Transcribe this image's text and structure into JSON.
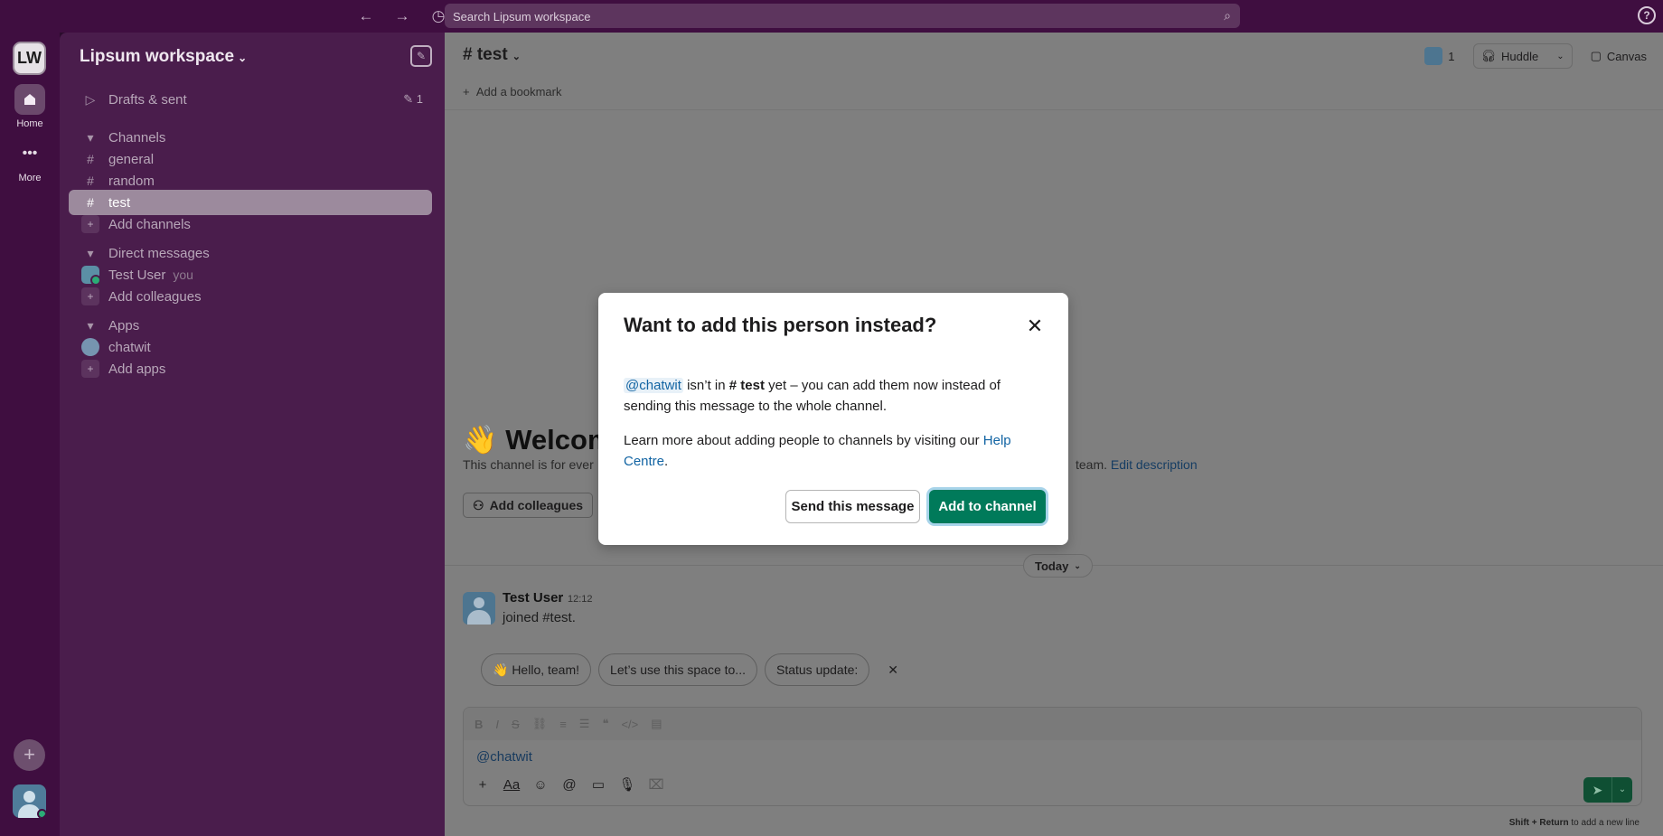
{
  "topbar": {
    "search_placeholder": "Search Lipsum workspace",
    "back_icon": "←",
    "forward_icon": "→",
    "history_icon": "◷",
    "help_icon": "?"
  },
  "rail": {
    "workspace_initials": "LW",
    "home_label": "Home",
    "more_label": "More"
  },
  "sidebar": {
    "workspace_name": "Lipsum workspace",
    "drafts_label": "Drafts & sent",
    "drafts_count": "1",
    "channels_header": "Channels",
    "channels": [
      "general",
      "random",
      "test"
    ],
    "add_channels": "Add channels",
    "dm_header": "Direct messages",
    "dm_user": "Test User",
    "dm_you": "you",
    "add_colleagues": "Add colleagues",
    "apps_header": "Apps",
    "app_name": "chatwit",
    "add_apps": "Add apps"
  },
  "channel": {
    "title": "test",
    "bookmark": "Add a bookmark",
    "member_count": "1",
    "huddle": "Huddle",
    "canvas": "Canvas",
    "welcome_emoji": "👋",
    "welcome_title": "Welcome",
    "welcome_desc_start": "This channel is for ever",
    "welcome_desc_end": "team.",
    "edit_description": "Edit description",
    "add_colleagues_btn": "Add colleagues",
    "today_label": "Today"
  },
  "message": {
    "author": "Test User",
    "time": "12:12",
    "text": "joined #test."
  },
  "suggestions": [
    "👋 Hello, team!",
    "Let’s use this space to...",
    "Status update:"
  ],
  "composer": {
    "text": "@chatwit",
    "hint_keys": "Shift + Return",
    "hint_rest": " to add a new line"
  },
  "modal": {
    "title": "Want to add this person instead?",
    "mention": "@chatwit",
    "p1_mid": " isn’t in ",
    "p1_channel": "# test",
    "p1_end": " yet – you can add them now instead of sending this message to the whole channel.",
    "p2_start": "Learn more about adding people to channels by visiting our ",
    "p2_link": "Help Centre",
    "p2_end": ".",
    "secondary_button": "Send this message",
    "primary_button": "Add to channel"
  },
  "colors": {
    "accent_green": "#007a5a",
    "sidebar_bg": "#4a1d4c",
    "link_blue": "#1264a3"
  }
}
